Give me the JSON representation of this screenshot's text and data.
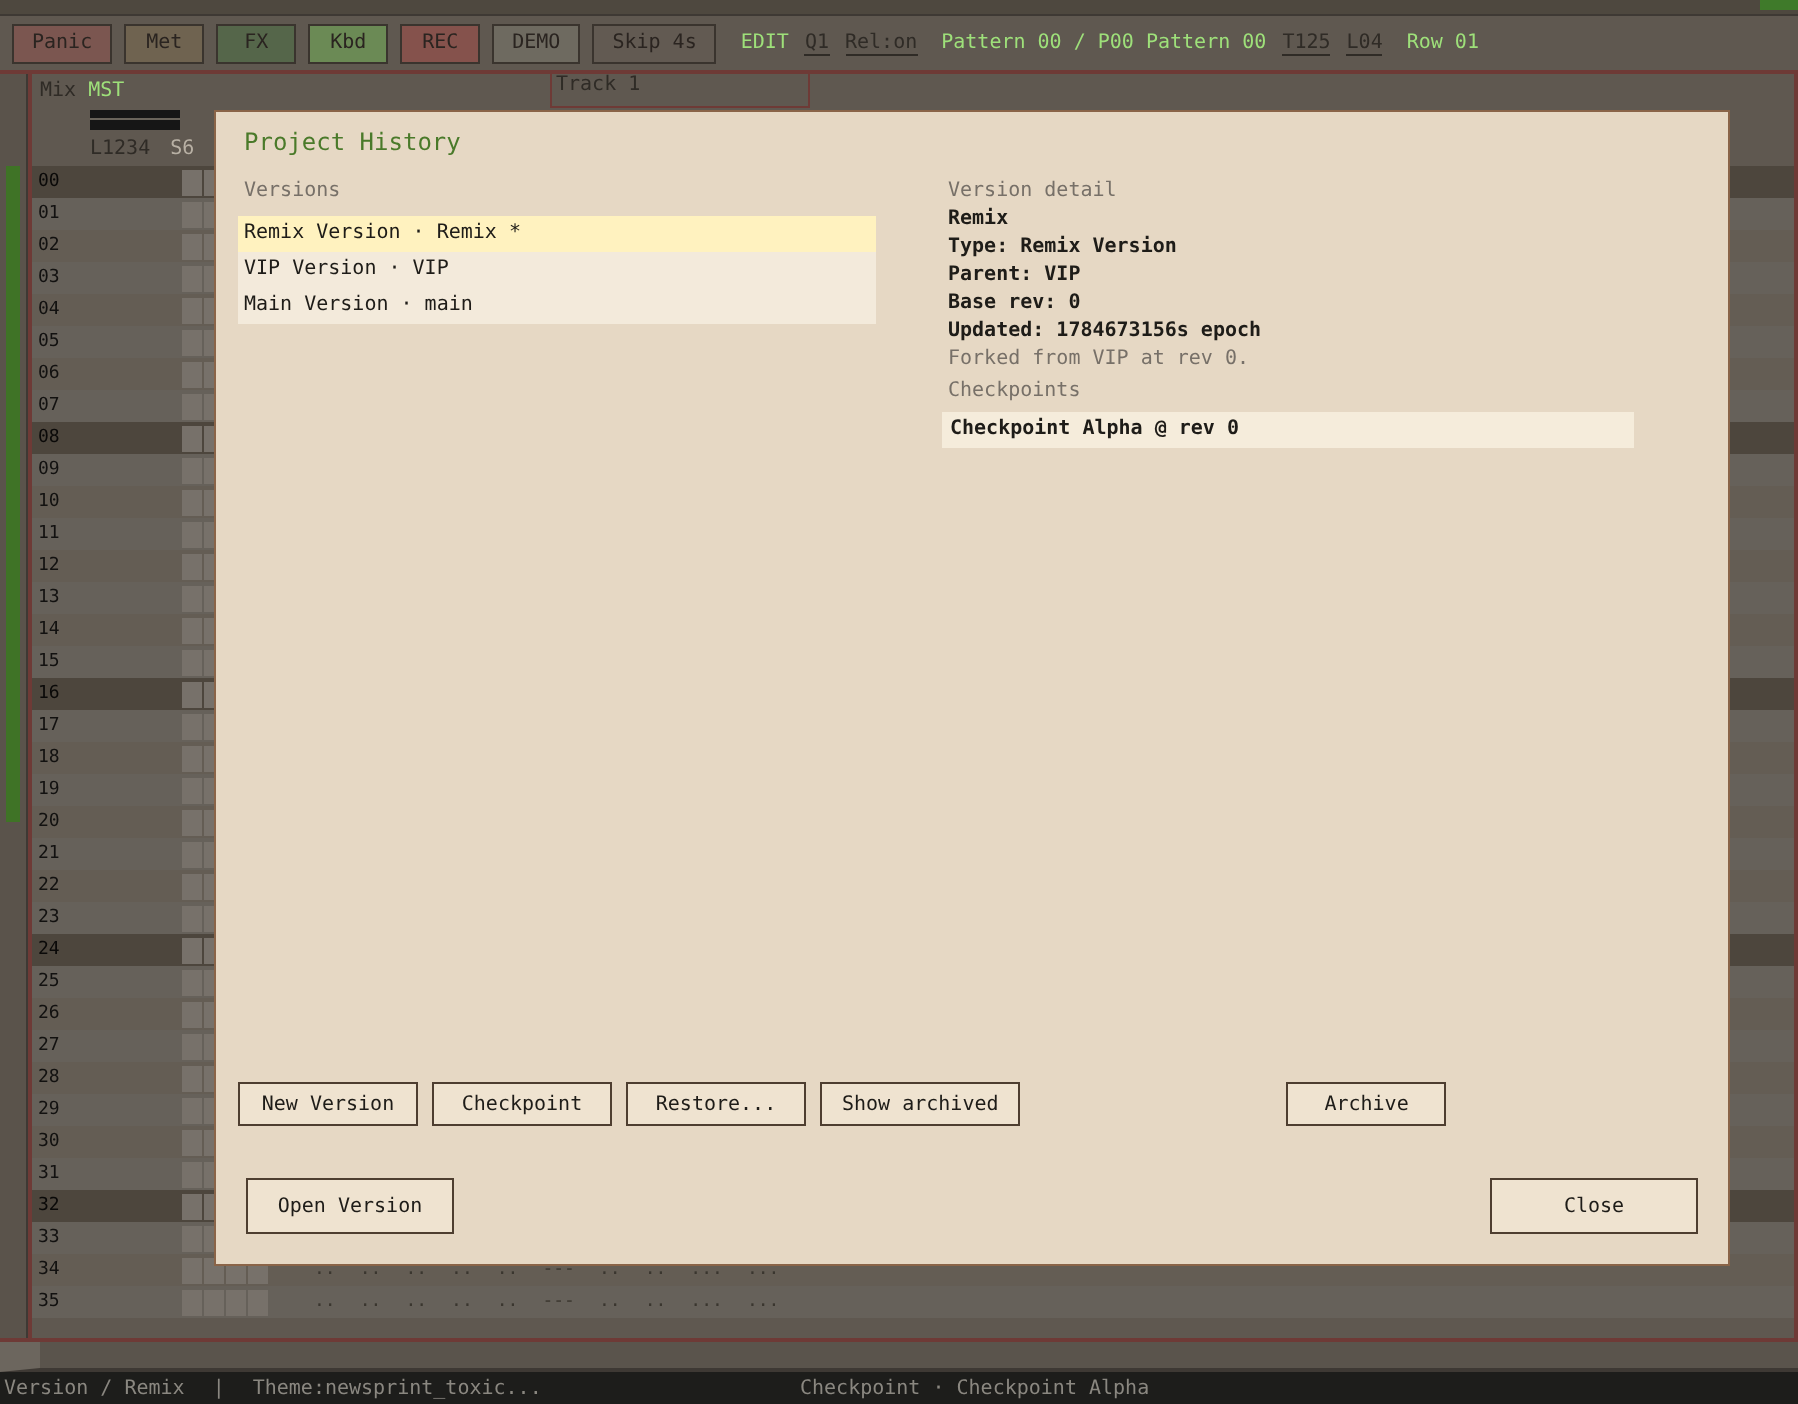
{
  "toolbar": {
    "buttons": [
      {
        "label": "Panic",
        "color": "#7b5650"
      },
      {
        "label": "Met",
        "color": "#6f6350"
      },
      {
        "label": "FX",
        "color": "#55664a"
      },
      {
        "label": "Kbd",
        "color": "#6b8a55"
      },
      {
        "label": "REC",
        "color": "#85524c"
      },
      {
        "label": "DEMO",
        "color": "#6e6a60"
      },
      {
        "label": "Skip 4s",
        "color": "#625a52"
      }
    ],
    "items": [
      {
        "label": "EDIT",
        "kind": "mode"
      },
      {
        "label": "Q1",
        "kind": "toggle"
      },
      {
        "label": "Rel:on",
        "kind": "toggle"
      },
      {
        "label": "Pattern 00 / P00 Pattern 00",
        "kind": "info"
      },
      {
        "label": "T125",
        "kind": "toggle"
      },
      {
        "label": "L04",
        "kind": "toggle"
      },
      {
        "label": "Row 01",
        "kind": "info"
      }
    ]
  },
  "mixer": {
    "label": "Mix",
    "channel": "MST",
    "column_labels": [
      "L1234",
      "S6"
    ]
  },
  "track": {
    "title": "Track 1"
  },
  "rows": [
    {
      "label": "00",
      "accent": true
    },
    {
      "label": "01",
      "accent": false
    },
    {
      "label": "02",
      "accent": false
    },
    {
      "label": "03",
      "accent": false
    },
    {
      "label": "04",
      "accent": false
    },
    {
      "label": "05",
      "accent": false
    },
    {
      "label": "06",
      "accent": false
    },
    {
      "label": "07",
      "accent": false
    },
    {
      "label": "08",
      "accent": true
    },
    {
      "label": "09",
      "accent": false
    },
    {
      "label": "10",
      "accent": false
    },
    {
      "label": "11",
      "accent": false
    },
    {
      "label": "12",
      "accent": false
    },
    {
      "label": "13",
      "accent": false
    },
    {
      "label": "14",
      "accent": false
    },
    {
      "label": "15",
      "accent": false
    },
    {
      "label": "16",
      "accent": true
    },
    {
      "label": "17",
      "accent": false
    },
    {
      "label": "18",
      "accent": false
    },
    {
      "label": "19",
      "accent": false
    },
    {
      "label": "20",
      "accent": false
    },
    {
      "label": "21",
      "accent": false
    },
    {
      "label": "22",
      "accent": false
    },
    {
      "label": "23",
      "accent": false
    },
    {
      "label": "24",
      "accent": true
    },
    {
      "label": "25",
      "accent": false
    },
    {
      "label": "26",
      "accent": false
    },
    {
      "label": "27",
      "accent": false
    },
    {
      "label": "28",
      "accent": false
    },
    {
      "label": "29",
      "accent": false
    },
    {
      "label": "30",
      "accent": false
    },
    {
      "label": "31",
      "accent": false
    },
    {
      "label": "32",
      "accent": true
    },
    {
      "label": "33",
      "accent": false
    },
    {
      "label": "34",
      "accent": false,
      "notes": [
        "..",
        "..",
        "..",
        "..",
        "..",
        "---",
        "..",
        "..",
        "...",
        "..."
      ]
    },
    {
      "label": "35",
      "accent": false,
      "notes": [
        "..",
        "..",
        "..",
        "..",
        "..",
        "---",
        "..",
        "..",
        "...",
        "..."
      ]
    }
  ],
  "dialog": {
    "title": "Project History",
    "versions": {
      "label": "Versions",
      "items": [
        {
          "label": "Remix Version · Remix *",
          "selected": true
        },
        {
          "label": "VIP Version · VIP",
          "selected": false
        },
        {
          "label": "Main Version · main",
          "selected": false
        }
      ]
    },
    "detail": {
      "label": "Version detail",
      "lines": [
        "Remix",
        "Type: Remix Version",
        "Parent: VIP",
        "Base rev: 0",
        "Updated: 1784673156s epoch"
      ],
      "note": "Forked from VIP at rev 0.",
      "checkpoints_label": "Checkpoints",
      "checkpoints": [
        "Checkpoint Alpha @ rev 0"
      ]
    },
    "actions": [
      "New Version",
      "Checkpoint",
      "Restore...",
      "Show archived"
    ],
    "archive_button": "Archive",
    "open_button": "Open Version",
    "close_button": "Close"
  },
  "status_bar": {
    "left": [
      "Version / Remix",
      "|",
      "Theme:newsprint_toxic..."
    ],
    "center": "Checkpoint · Checkpoint Alpha"
  }
}
